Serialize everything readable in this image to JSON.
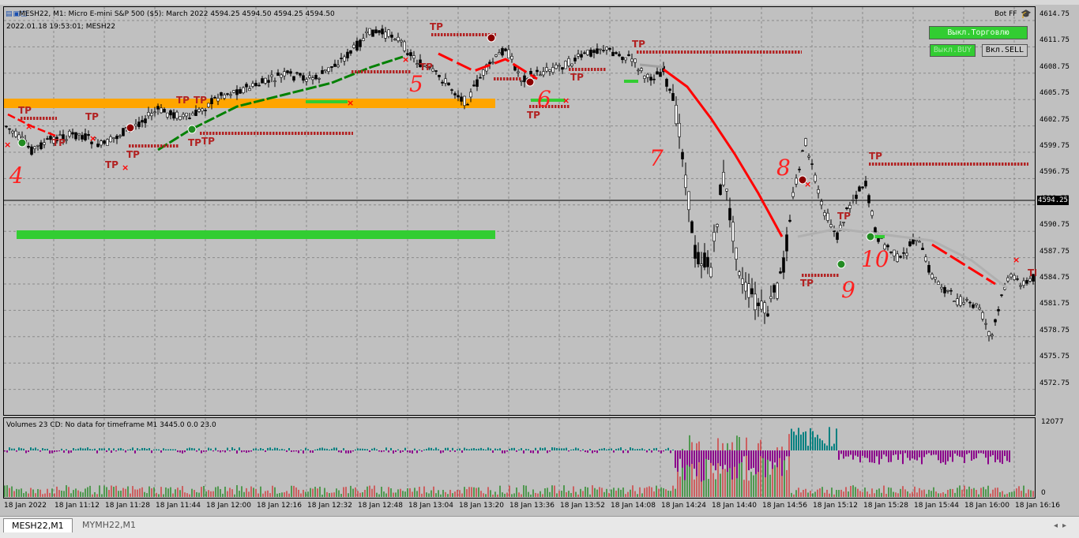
{
  "header": {
    "symbol_title": "MESH22, M1:  Micro E-mini S&P 500 ($5): March 2022  4594.25 4594.50 4594.25 4594.50",
    "timestamp_line": "2022.01.18 19:53:01; MESH22",
    "bot_label": "Bot FF"
  },
  "buttons": {
    "trade_off": "Выкл.Торговлю",
    "buy_off": "Выкл.BUY",
    "sell_on": "Вкл.SELL"
  },
  "price_axis": {
    "ticks": [
      "4614.75",
      "4611.75",
      "4608.75",
      "4605.75",
      "4602.75",
      "4599.75",
      "4596.75",
      "4593.75",
      "4590.75",
      "4587.75",
      "4584.75",
      "4581.75",
      "4578.75",
      "4575.75",
      "4572.75"
    ],
    "current_price": "4594.25"
  },
  "volume_pane": {
    "label": "Volumes 23 CD: No data for timeframe M1 3445.0 0.0 23.0",
    "max_tick": "12077",
    "min_tick": "0"
  },
  "time_axis": {
    "labels": [
      "18 Jan 2022",
      "18 Jan 11:12",
      "18 Jan 11:28",
      "18 Jan 11:44",
      "18 Jan 12:00",
      "18 Jan 12:16",
      "18 Jan 12:32",
      "18 Jan 12:48",
      "18 Jan 13:04",
      "18 Jan 13:20",
      "18 Jan 13:36",
      "18 Jan 13:52",
      "18 Jan 14:08",
      "18 Jan 14:24",
      "18 Jan 14:40",
      "18 Jan 14:56",
      "18 Jan 15:12",
      "18 Jan 15:28",
      "18 Jan 15:44",
      "18 Jan 16:00",
      "18 Jan 16:16"
    ]
  },
  "tabs": [
    {
      "label": "MESH22,M1",
      "active": true
    },
    {
      "label": "MYMH22,M1",
      "active": false
    }
  ],
  "annotations": {
    "tp_text": "TP",
    "numbers": [
      "4",
      "5",
      "6",
      "7",
      "8",
      "9",
      "10"
    ]
  },
  "colors": {
    "background": "#c0c0c0",
    "bull_candle": "#000000",
    "bear_candle": "#ffffff",
    "green_zone": "#32cd32",
    "orange_zone": "#ffa500",
    "tp_red": "#b22222",
    "down_trend": "#ff0000",
    "up_trend": "#008000",
    "vol_purple": "#8b008b",
    "vol_teal": "#008080"
  }
}
